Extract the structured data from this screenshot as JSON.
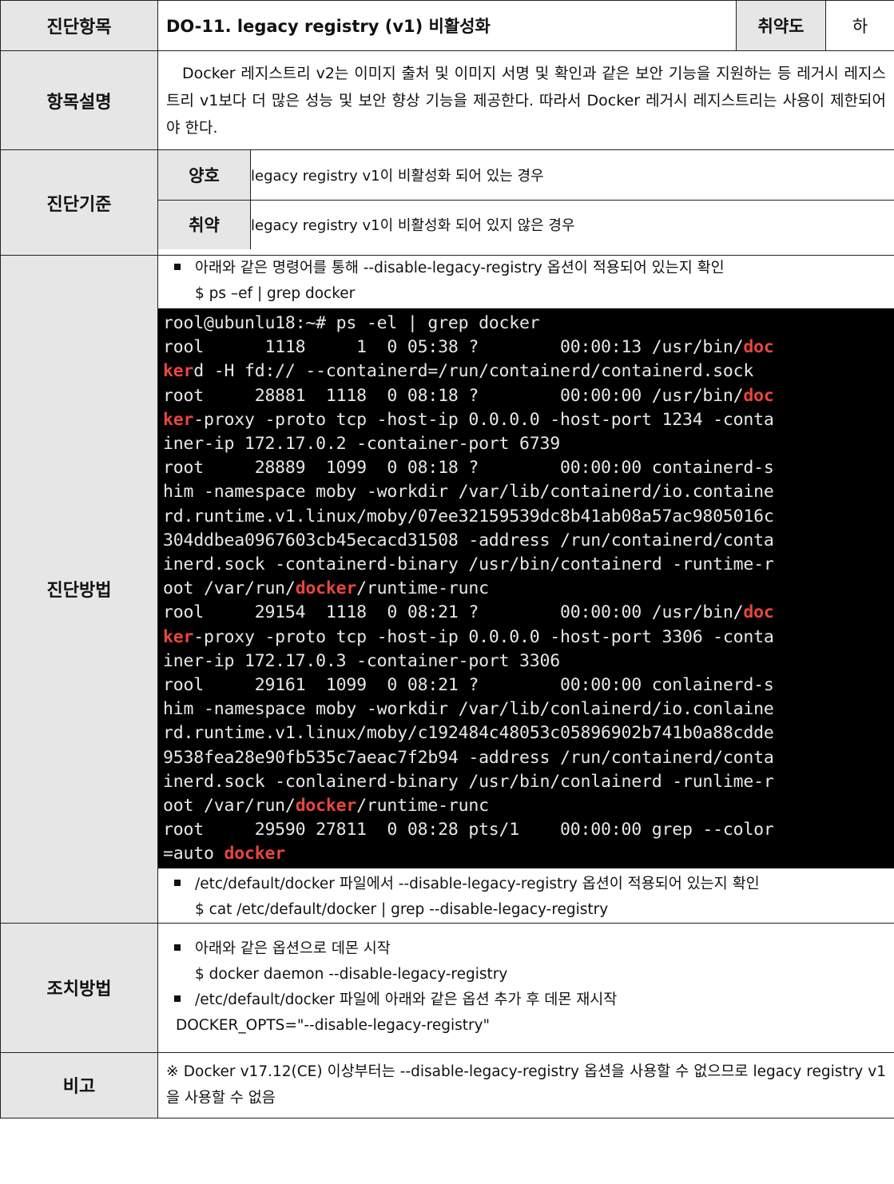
{
  "header": {
    "item_label": "진단항목",
    "item_title": "DO-11. legacy registry (v1) 비활성화",
    "vuln_label": "취약도",
    "vuln_value": "하"
  },
  "description": {
    "label": "항목설명",
    "text": "Docker 레지스트리 v2는 이미지 출처 및 이미지 서명 및 확인과 같은 보안 기능을 지원하는 등 레거시 레지스트리 v1보다 더 많은 성능 및 보안 향상 기능을 제공한다. 따라서 Docker 레거시 레지스트리는 사용이 제한되어야 한다."
  },
  "criteria": {
    "label": "진단기준",
    "good_label": "양호",
    "good_text": "legacy registry v1이 비활성화 되어 있는 경우",
    "bad_label": "취약",
    "bad_text": "legacy registry v1이 비활성화 되어 있지 않은 경우"
  },
  "method": {
    "label": "진단방법",
    "bullet1": "아래와 같은 명령어를 통해 --disable-legacy-registry 옵션이 적용되어 있는지 확인",
    "cmd1": "$ ps –ef | grep docker",
    "terminal_lines": [
      [
        "rool@ubunlu18:~# ps -el | grep docker"
      ],
      [
        "rool      1118     1  0 05:38 ?        00:00:13 /usr/bin/",
        "doc"
      ],
      [
        "",
        "ker",
        "d -H fd:// --containerd=/run/containerd/containerd.sock"
      ],
      [
        "root     28881  1118  0 08:18 ?        00:00:00 /usr/bin/",
        "doc"
      ],
      [
        "",
        "ker",
        "-proxy -proto tcp -host-ip 0.0.0.0 -host-port 1234 -conta"
      ],
      [
        "iner-ip 172.17.0.2 -container-port 6739"
      ],
      [
        "root     28889  1099  0 08:18 ?        00:00:00 containerd-s"
      ],
      [
        "him -namespace moby -workdir /var/lib/containerd/io.containe"
      ],
      [
        "rd.runtime.v1.linux/moby/07ee32159539dc8b41ab08a57ac9805016c"
      ],
      [
        "304ddbea0967603cb45ecacd31508 -address /run/containerd/conta"
      ],
      [
        "inerd.sock -containerd-binary /usr/bin/containerd -runtime-r"
      ],
      [
        "oot /var/run/",
        "docker",
        "/runtime-runc"
      ],
      [
        "rool     29154  1118  0 08:21 ?        00:00:00 /usr/bin/",
        "doc"
      ],
      [
        "",
        "ker",
        "-proxy -proto tcp -host-ip 0.0.0.0 -host-port 3306 -conta"
      ],
      [
        "iner-ip 172.17.0.3 -container-port 3306"
      ],
      [
        "rool     29161  1099  0 08:21 ?        00:00:00 conlainerd-s"
      ],
      [
        "him -namespace moby -workdir /var/lib/conlainerd/io.conlaine"
      ],
      [
        "rd.runtime.v1.linux/moby/c192484c48053c05896902b741b0a88cdde"
      ],
      [
        "9538fea28e90fb535c7aeac7f2b94 -address /run/containerd/conta"
      ],
      [
        "inerd.sock -conlainerd-binary /usr/bin/conlainerd -runlime-r"
      ],
      [
        "oot /var/run/",
        "docker",
        "/runtime-runc"
      ],
      [
        "root     29590 27811  0 08:28 pts/1    00:00:00 grep --color"
      ],
      [
        "=auto ",
        "docker",
        ""
      ]
    ],
    "bullet2": "/etc/default/docker 파일에서 --disable-legacy-registry 옵션이 적용되어 있는지 확인",
    "cmd2": "$ cat /etc/default/docker | grep --disable-legacy-registry"
  },
  "action": {
    "label": "조치방법",
    "bullet1": "아래와 같은 옵션으로 데몬 시작",
    "cmd1": "$ docker daemon --disable-legacy-registry",
    "bullet2": "/etc/default/docker 파일에 아래와 같은 옵션 추가 후 데몬 재시작",
    "opts": "DOCKER_OPTS=\"--disable-legacy-registry\""
  },
  "remark": {
    "label": "비고",
    "text": "※ Docker v17.12(CE) 이상부터는 --disable-legacy-registry 옵션을 사용할 수 없으므로 legacy registry v1을 사용할 수 없음"
  }
}
